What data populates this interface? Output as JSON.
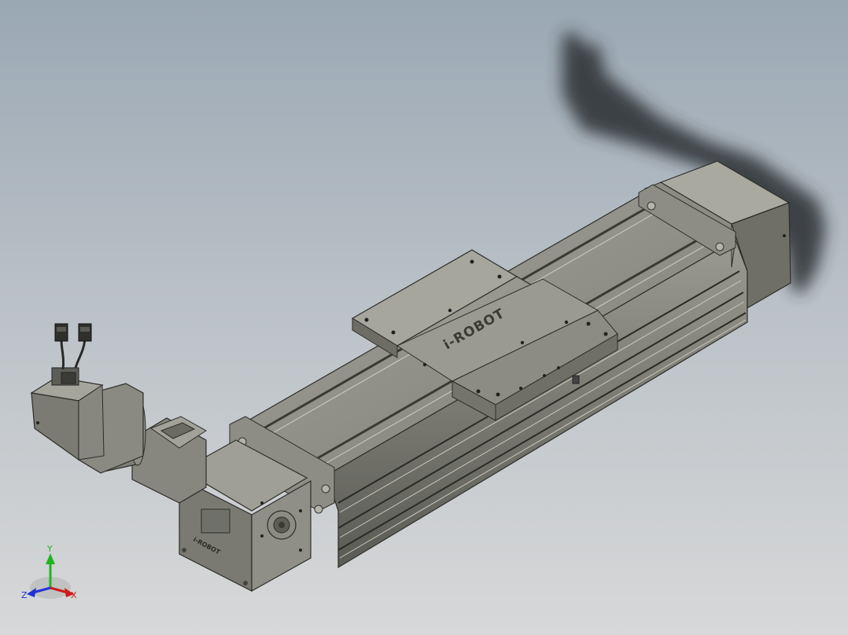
{
  "viewport": {
    "background_top": "#9aa8b4",
    "background_bottom": "#d7d8d9"
  },
  "model": {
    "brand_logo_text": "i-ROBOT",
    "carriage_logo_text": "i-ROBOT",
    "gearbox_logo_text": "i-ROBOT"
  },
  "triad": {
    "x_label": "X",
    "y_label": "Y",
    "z_label": "Z",
    "x_color": "#d11a1a",
    "y_color": "#1fb51f",
    "z_color": "#2231d6"
  }
}
